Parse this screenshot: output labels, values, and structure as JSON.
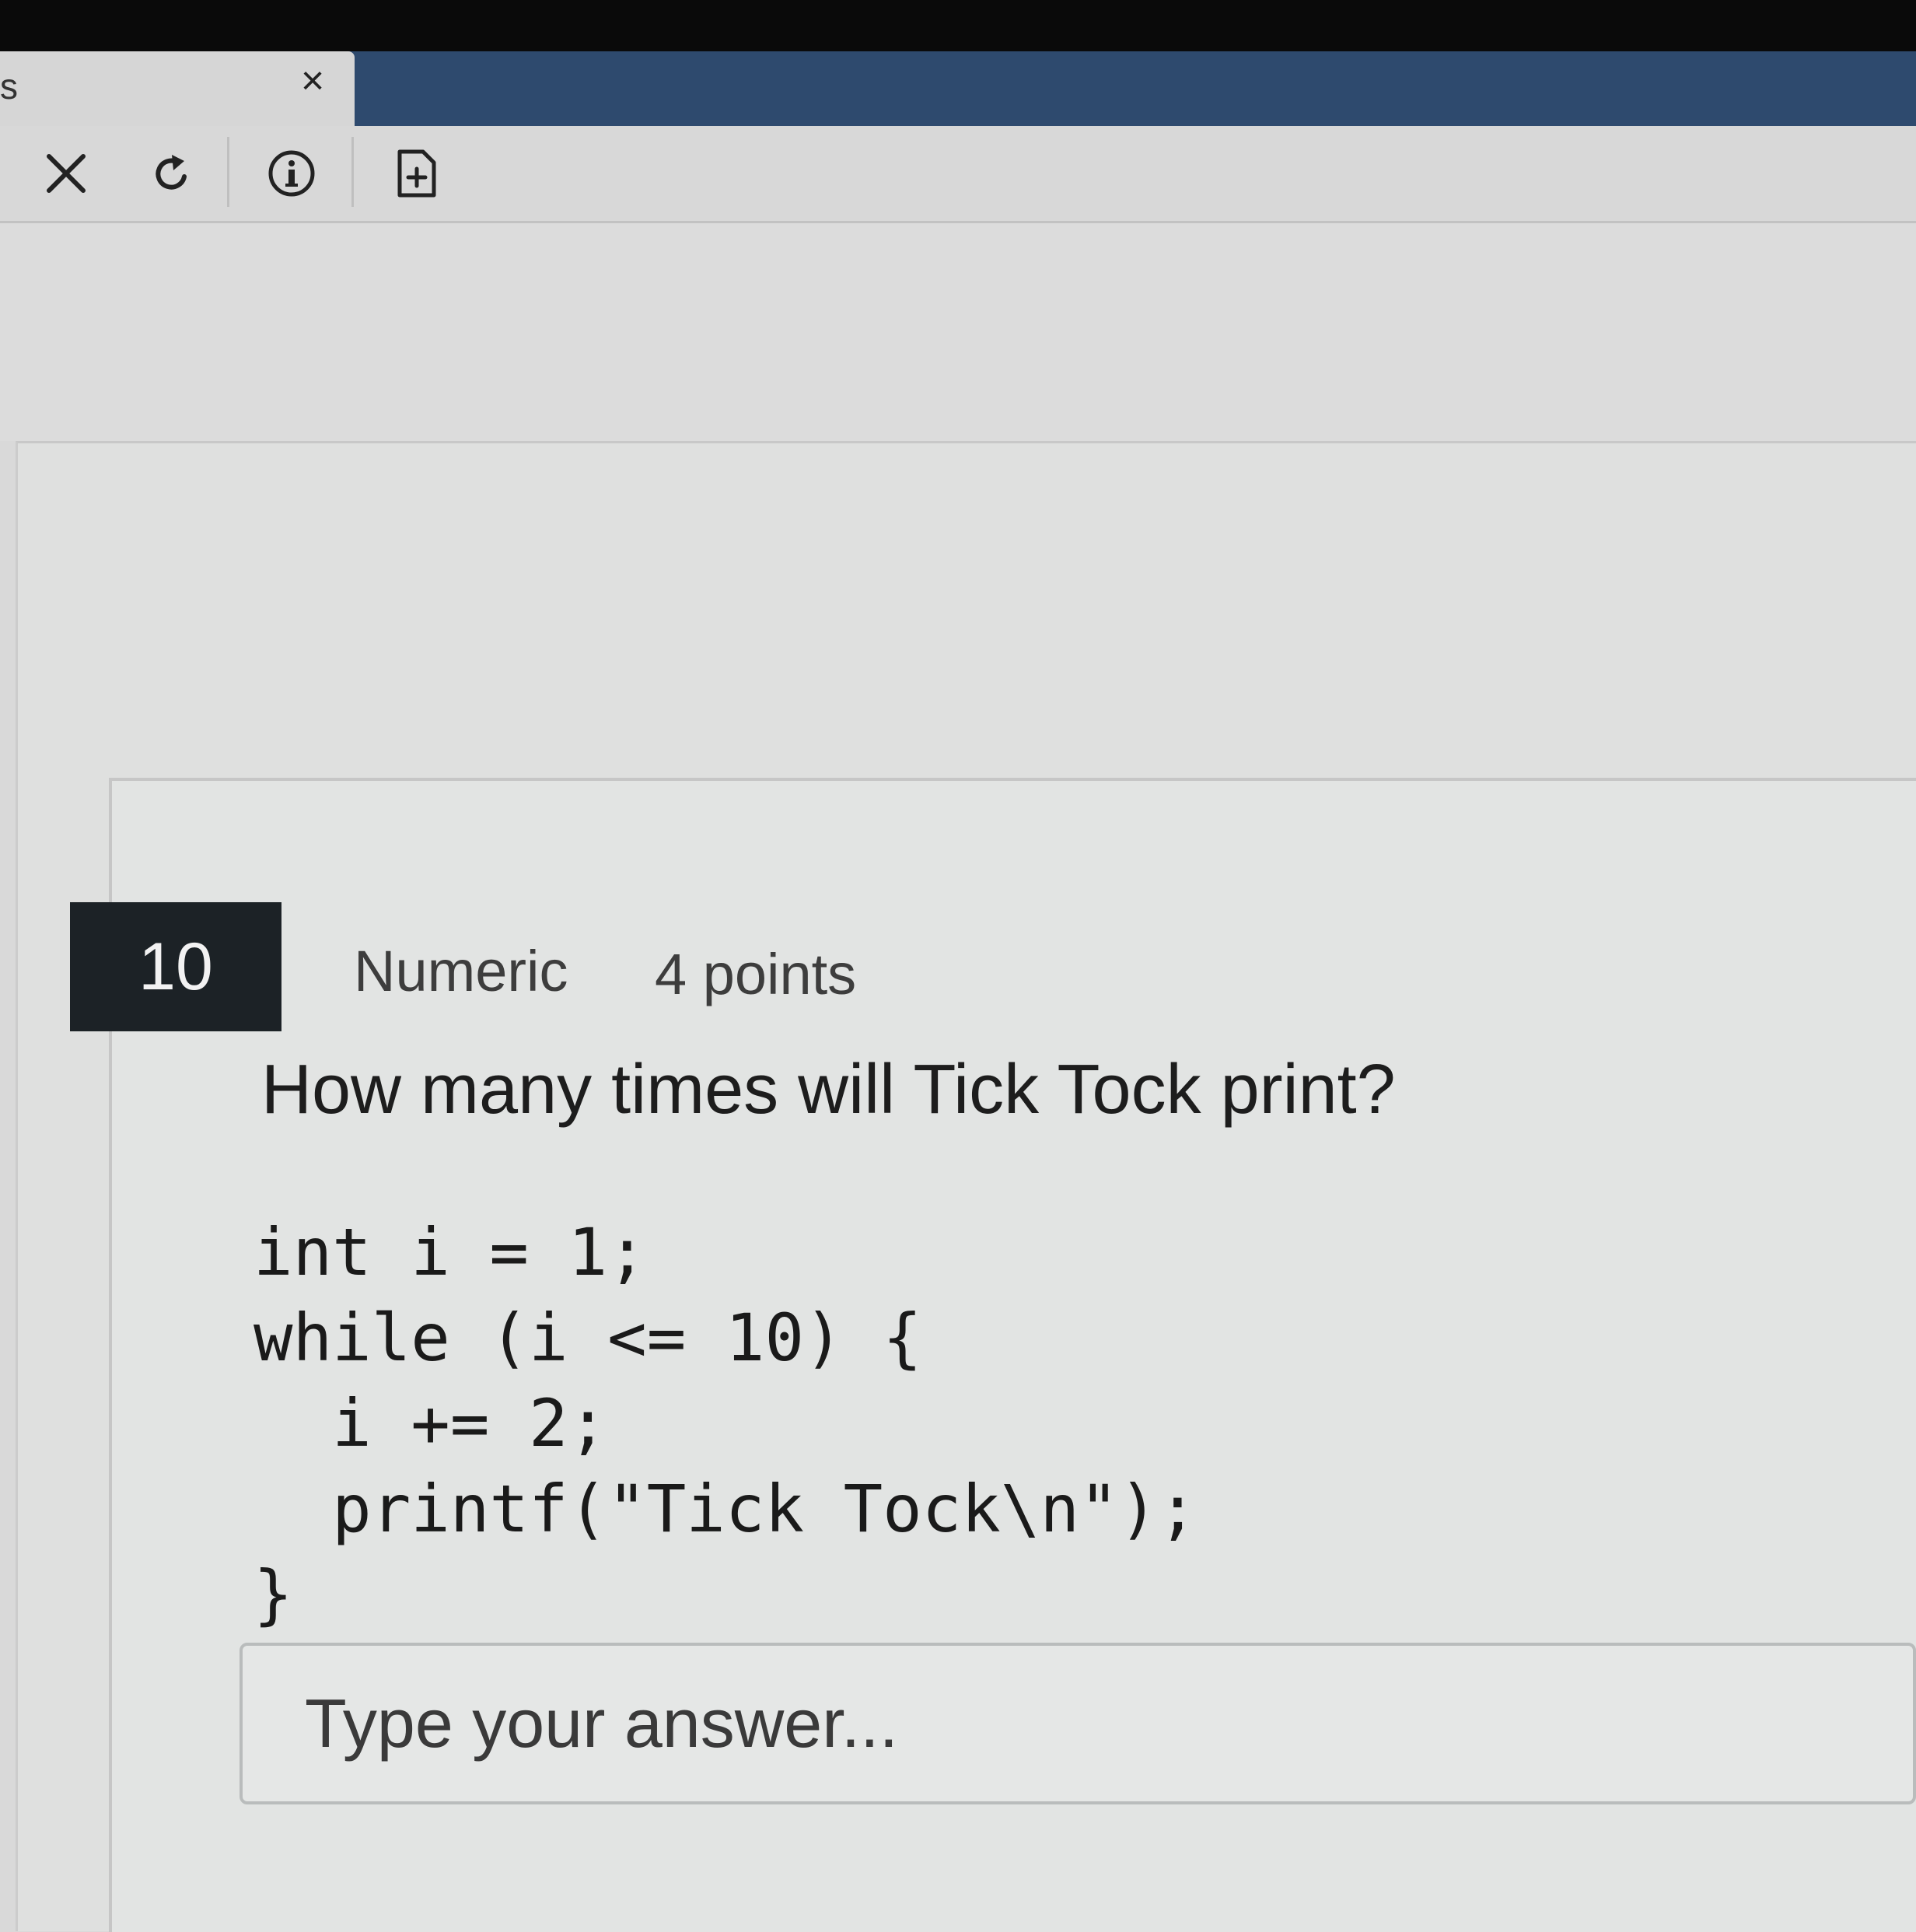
{
  "browser": {
    "tab_title": "s",
    "tab_close_glyph": "×"
  },
  "toolbar": {
    "buttons": [
      {
        "name": "close-icon"
      },
      {
        "name": "reload-icon"
      },
      {
        "name": "info-icon"
      },
      {
        "name": "add-page-icon"
      }
    ]
  },
  "question": {
    "number": "10",
    "type": "Numeric",
    "points": "4 points",
    "text": "How many times will Tick Tock print?",
    "code_lines": [
      "int i = 1;",
      "while (i <= 10) {",
      "  i += 2;",
      "  printf(\"Tick Tock\\n\");",
      "}"
    ],
    "answer_placeholder": "Type your answer..."
  }
}
